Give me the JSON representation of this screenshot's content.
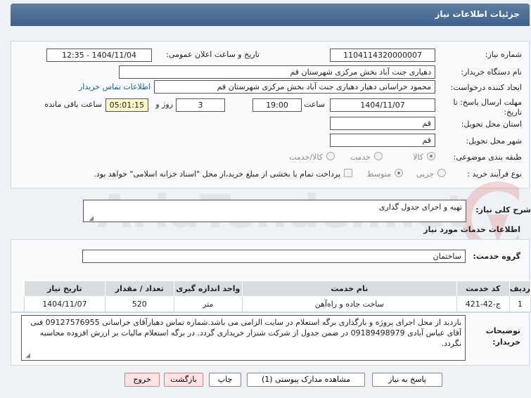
{
  "header": {
    "title": "جزئیات اطلاعات نیاز"
  },
  "form": {
    "need_number_label": "شماره نیاز:",
    "need_number": "1104114320000007",
    "announce_label": "تاریخ و ساعت اعلان عمومی:",
    "announce_value": "1404/11/04 - 12:35",
    "buyer_org_label": "نام دستگاه خریدار:",
    "buyer_org": "دهیاری جنت آباد بخش مرکزی شهرستان قم",
    "creator_label": "ایجاد کننده درخواست:",
    "creator": "محمود خراسانی دهیار  دهیاری جنت آباد بخش مرکزی شهرستان قم",
    "contact_link": "اطلاعات تماس خریدار",
    "deadline_label": "مهلت ارسال پاسخ: تا تاریخ:",
    "deadline_date": "1404/11/07",
    "time_label": "ساعت",
    "deadline_time": "19:00",
    "days": "3",
    "days_label": "روز و",
    "remaining": "05:01:15",
    "remaining_label": "ساعت باقی مانده",
    "province_label": "استان محل تحویل:",
    "province": "قم",
    "city_label": "شهر محل تحویل:",
    "city": "قم",
    "category_label": "طبقه بندی موضوعی:",
    "category_options": [
      "کالا",
      "خدمت",
      "کالا/خدمت"
    ],
    "process_label": "نوع فرآیند خرید :",
    "process_options": [
      "جزیی",
      "متوسط"
    ],
    "payment_note": "پرداخت تمام یا بخشی از مبلغ خرید،از محل \"اسناد خزانه اسلامی\" خواهد بود."
  },
  "description": {
    "label": "شرح کلی نیاز:",
    "value": "تهیه و اجرای جدول گذاری"
  },
  "services": {
    "section_title": "اطلاعات خدمات مورد نیاز",
    "group_label": "گروه خدمت:",
    "group_value": "ساختمان",
    "columns": [
      "ردیف",
      "کد خدمت",
      "نام خدمت",
      "واحد اندازه گیری",
      "تعداد / مقدار",
      "تاریخ نیاز"
    ],
    "rows": [
      [
        "1",
        "ج-42-421",
        "ساخت جاده و راه‌آهن",
        "متر",
        "520",
        "1404/11/07"
      ]
    ]
  },
  "buyer_notes": {
    "label": "توضیحات خریدار:",
    "value": "بازدید از محل اجرای پروژه و بارگذاری برگه استعلام در سایت الزامی می باشد.شماره تماس دهیارآقای خراسانی 09127576955  فنی آقای عباس آبادی 09189498979 در ضمن جدول از شرکت شنزار خریداری گردد. در برگه استعلام مالیات بر ارزش افزوده محاسبه نگردد."
  },
  "buttons": {
    "reply": "پاسخ به نیاز",
    "attachments": "مشاهده مدارک پیوستی (1)",
    "print": "چاپ",
    "back": "بازگشت",
    "exit": "خروج"
  },
  "watermark": {
    "text": "AriaTender.net"
  }
}
